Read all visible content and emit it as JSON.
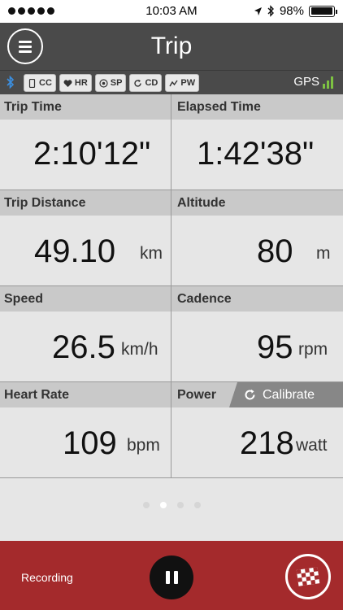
{
  "status_bar": {
    "time": "10:03 AM",
    "battery_text": "98%",
    "battery_level": 0.98,
    "signal_dots": 5,
    "icons": [
      "location-arrow-icon",
      "bluetooth-icon",
      "battery-icon"
    ]
  },
  "nav": {
    "title": "Trip",
    "menu_icon": "hamburger-menu-icon"
  },
  "sensors": {
    "chips": [
      {
        "label": "CC",
        "icon": "phone-icon"
      },
      {
        "label": "HR",
        "icon": "heart-icon"
      },
      {
        "label": "SP",
        "icon": "target-icon"
      },
      {
        "label": "CD",
        "icon": "refresh-icon"
      },
      {
        "label": "PW",
        "icon": "zigzag-icon"
      }
    ],
    "gps_label": "GPS",
    "gps_bars_active": 3
  },
  "metrics": {
    "trip_time": {
      "label": "Trip Time",
      "value": "2:10'12\""
    },
    "elapsed_time": {
      "label": "Elapsed Time",
      "value": "1:42'38\""
    },
    "trip_distance": {
      "label": "Trip Distance",
      "value": "49.10",
      "unit": "km"
    },
    "altitude": {
      "label": "Altitude",
      "value": "80",
      "unit": "m"
    },
    "speed": {
      "label": "Speed",
      "value": "26.5",
      "unit": "km/h"
    },
    "cadence": {
      "label": "Cadence",
      "value": "95",
      "unit": "rpm"
    },
    "heart_rate": {
      "label": "Heart Rate",
      "value": "109",
      "unit": "bpm"
    },
    "power": {
      "label": "Power",
      "value": "218",
      "unit": "watt",
      "calibrate_label": "Calibrate"
    }
  },
  "pager": {
    "pages": 4,
    "current": 2
  },
  "footer": {
    "recording_label": "Recording",
    "colors": {
      "background": "#a42a2c"
    }
  },
  "colors": {
    "header_bg": "#4a4a4a",
    "cell_header_bg": "#c9c9c9",
    "gps_green": "#7dc242",
    "bluetooth_blue": "#3b8fe0"
  }
}
